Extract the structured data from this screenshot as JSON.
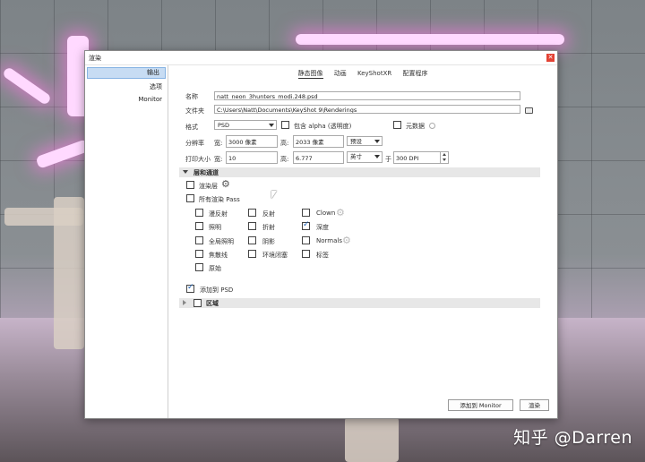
{
  "window": {
    "title": "渲染",
    "close_glyph": "✕"
  },
  "sidebar": {
    "items": [
      {
        "label": "输出",
        "active": true
      },
      {
        "label": "选项",
        "active": false
      },
      {
        "label": "Monitor",
        "active": false
      }
    ]
  },
  "tabs": [
    {
      "label": "静态图像",
      "active": true
    },
    {
      "label": "动画",
      "active": false
    },
    {
      "label": "KeyShotXR",
      "active": false
    },
    {
      "label": "配置程序",
      "active": false
    }
  ],
  "form": {
    "name_label": "名称",
    "name_value": "natt_neon_3hunters_modi.248.psd",
    "folder_label": "文件夹",
    "folder_value": "C:\\Users\\Natt\\Documents\\KeyShot 9\\Renderings",
    "format_label": "格式",
    "format_value": "PSD",
    "alpha_label": "包含 alpha (透明度)",
    "alpha_checked": false,
    "metadata_label": "元数据",
    "metadata_checked": false,
    "resolution_label": "分辨率",
    "width_label": "宽:",
    "resolution_width": "3000 像素",
    "height_label": "高:",
    "resolution_height": "2033 像素",
    "preset_label": "预设",
    "print_label": "打印大小",
    "print_width": "10",
    "print_height": "6.777",
    "print_unit": "英寸",
    "at_label": "于",
    "dpi_value": "300 DPI"
  },
  "layers": {
    "section_label": "层和通道",
    "render_layers_label": "渲染层",
    "render_layers_checked": false,
    "all_passes_label": "所有渲染 Pass",
    "all_passes_checked": false,
    "passes": [
      {
        "label": "漫反射",
        "checked": false
      },
      {
        "label": "反射",
        "checked": false
      },
      {
        "label": "Clown",
        "checked": false
      },
      {
        "label": "照明",
        "checked": false
      },
      {
        "label": "折射",
        "checked": false
      },
      {
        "label": "深度",
        "checked": true
      },
      {
        "label": "全局照明",
        "checked": false
      },
      {
        "label": "阴影",
        "checked": false
      },
      {
        "label": "Normals",
        "checked": false
      },
      {
        "label": "焦散线",
        "checked": false
      },
      {
        "label": "环境闭塞",
        "checked": false
      },
      {
        "label": "标签",
        "checked": false
      },
      {
        "label": "原始",
        "checked": false
      }
    ],
    "add_to_psd_label": "添加到 PSD",
    "add_to_psd_checked": true
  },
  "region": {
    "section_label": "区域",
    "checked": false
  },
  "buttons": {
    "add_to_monitor": "添加到 Monitor",
    "render": "渲染"
  },
  "watermark": "知乎 @Darren",
  "icons": {
    "gear": "⚙",
    "checkmark": "✓"
  }
}
